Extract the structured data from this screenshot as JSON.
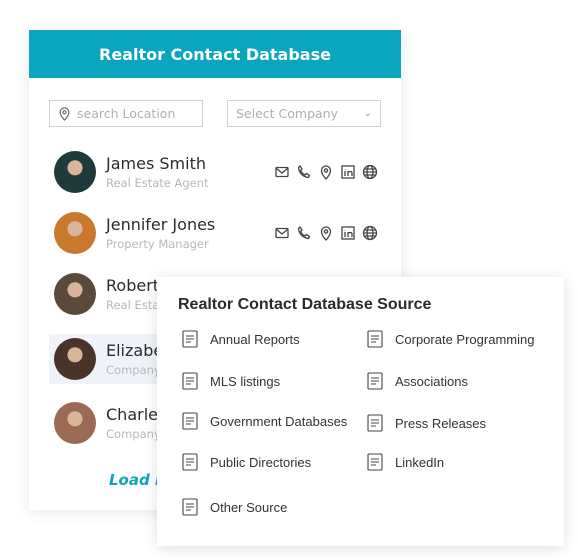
{
  "colors": {
    "accent": "#0ba5bf"
  },
  "card": {
    "title": "Realtor Contact Database",
    "search_placeholder": "search Location",
    "company_placeholder": "Select Company",
    "load_more": "Load More",
    "contacts": [
      {
        "name": "James Smith",
        "role": "Real Estate Agent",
        "avatar": "#1f3a3a"
      },
      {
        "name": "Jennifer Jones",
        "role": "Property Manager",
        "avatar": "#c9782e"
      },
      {
        "name": "Robert",
        "role": "Real Estate",
        "avatar": "#5a4a3a"
      },
      {
        "name": "Elizabeth",
        "role": "Company",
        "avatar": "#4a3328"
      },
      {
        "name": "Charles",
        "role": "Company",
        "avatar": "#9a6a55"
      }
    ]
  },
  "popup": {
    "title": "Realtor Contact Database Source",
    "items": [
      {
        "label": "Annual Reports",
        "icon": "annual-report-icon"
      },
      {
        "label": "Corporate Programming",
        "icon": "corporate-programming-icon"
      },
      {
        "label": "MLS listings",
        "icon": "mls-listings-icon"
      },
      {
        "label": "Associations",
        "icon": "associations-icon"
      },
      {
        "label": "Government Databases",
        "icon": "government-database-icon"
      },
      {
        "label": "Press Releases",
        "icon": "press-release-icon"
      },
      {
        "label": "Public Directories",
        "icon": "public-directory-icon"
      },
      {
        "label": "LinkedIn",
        "icon": "linkedin-icon"
      },
      {
        "label": "Other Source",
        "icon": "other-source-icon"
      }
    ]
  }
}
